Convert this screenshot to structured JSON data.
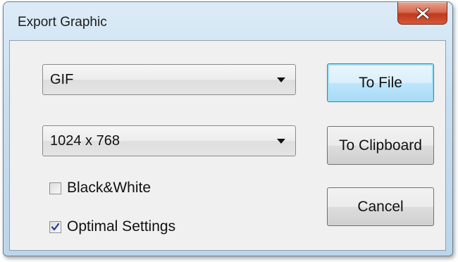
{
  "window": {
    "title": "Export Graphic"
  },
  "format_combo": {
    "selected": "GIF"
  },
  "size_combo": {
    "selected": "1024 x 768"
  },
  "checkboxes": [
    {
      "label": "Black&White",
      "checked": false
    },
    {
      "label": "Optimal Settings",
      "checked": true
    }
  ],
  "buttons": {
    "to_file": "To File",
    "to_clipboard": "To Clipboard",
    "cancel": "Cancel"
  },
  "icons": {
    "close": "close-icon",
    "dropdown": "chevron-down-icon",
    "check": "checkmark-icon"
  },
  "colors": {
    "close_button": "#c9472a",
    "default_button_border": "#3c7fb1",
    "check_mark": "#1e3f8f"
  }
}
